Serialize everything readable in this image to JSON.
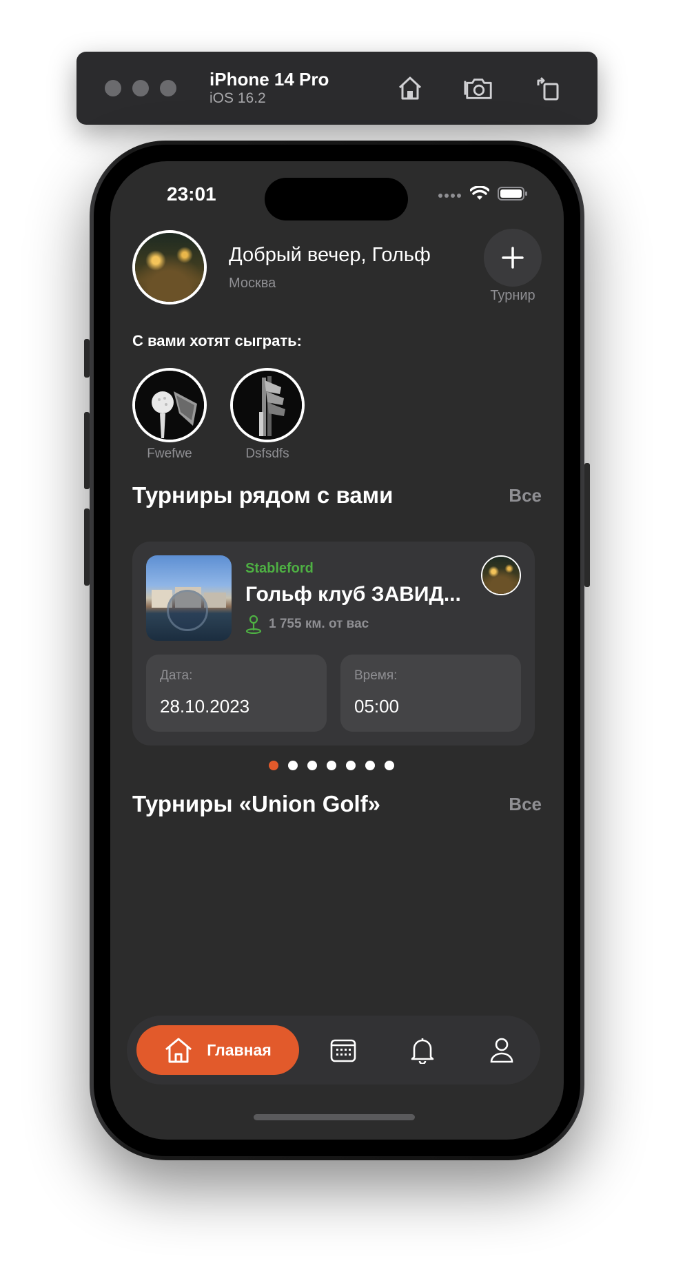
{
  "simulator": {
    "device_name": "iPhone 14 Pro",
    "os_version": "iOS 16.2",
    "icons": [
      "home-icon",
      "screenshot-icon",
      "rotate-icon"
    ]
  },
  "status_bar": {
    "time": "23:01",
    "icons": [
      "signal-icon",
      "wifi-icon",
      "battery-icon"
    ]
  },
  "header": {
    "greeting": "Добрый вечер, Гольф",
    "city": "Москва",
    "add_tournament_label": "Турнир"
  },
  "want_to_play": {
    "title": "С вами хотят сыграть:",
    "players": [
      {
        "name": "Fwefwe",
        "image": "golf-ball-on-tee"
      },
      {
        "name": "Dsfsdfs",
        "image": "golf-irons"
      }
    ]
  },
  "nearby": {
    "title": "Турниры рядом с вами",
    "see_all": "Все",
    "cards": [
      {
        "type": "Stableford",
        "name": "Гольф клуб ЗАВИД...",
        "distance": "1 755 км. от вас",
        "date_label": "Дата:",
        "date": "28.10.2023",
        "time_label": "Время:",
        "time": "05:00"
      }
    ],
    "pager": {
      "total": 7,
      "active": 1
    }
  },
  "union": {
    "title": "Турниры «Union Golf»",
    "see_all": "Все"
  },
  "tabbar": {
    "home_label": "Главная",
    "items": [
      "home-icon",
      "calendar-icon",
      "bell-icon",
      "profile-icon"
    ]
  },
  "colors": {
    "accent": "#e25a2b",
    "green": "#4eb043",
    "background": "#2c2c2c",
    "card": "#363638"
  }
}
